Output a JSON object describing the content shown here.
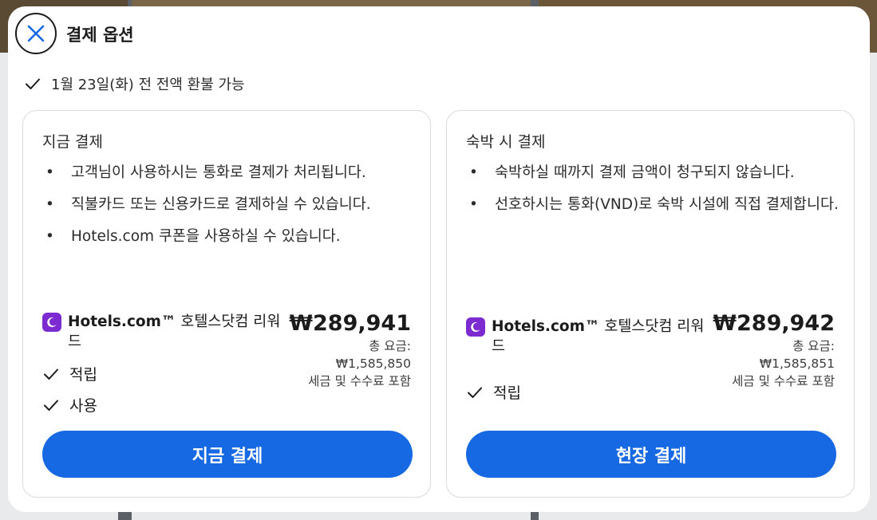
{
  "dialog": {
    "title": "결제 옵션",
    "refund_note": "1월 23일(화) 전 전액 환불 가능"
  },
  "options": [
    {
      "title": "지금 결제",
      "bullets": [
        "고객님이 사용하시는 통화로 결제가 처리됩니다.",
        "직불카드 또는 신용카드로 결제하실 수 있습니다.",
        "Hotels.com 쿠폰을 사용하실 수 있습니다."
      ],
      "reward_brand": "Hotels.com™",
      "reward_name": "호텔스닷컴 리워드",
      "reward_actions": [
        "적립",
        "사용"
      ],
      "price": "₩289,941",
      "total_label": "총 요금:",
      "total_amount": "₩1,585,850",
      "tax_note": "세금 및 수수료 포함",
      "button_label": "지금 결제"
    },
    {
      "title": "숙박 시 결제",
      "bullets": [
        "숙박하실 때까지 결제 금액이 청구되지 않습니다.",
        "선호하시는 통화(VND)로 숙박 시설에 직접 결제합니다."
      ],
      "reward_brand": "Hotels.com™",
      "reward_name": "호텔스닷컴 리워드",
      "reward_actions": [
        "적립"
      ],
      "price": "₩289,942",
      "total_label": "총 요금:",
      "total_amount": "₩1,585,851",
      "tax_note": "세금 및 수수료 포함",
      "button_label": "현장 결제"
    }
  ],
  "icons": {
    "close": "close-icon",
    "check": "check-icon",
    "reward_logo": "moon-icon"
  },
  "colors": {
    "accent": "#1668e3",
    "reward_brand": "#7b2bd0"
  }
}
